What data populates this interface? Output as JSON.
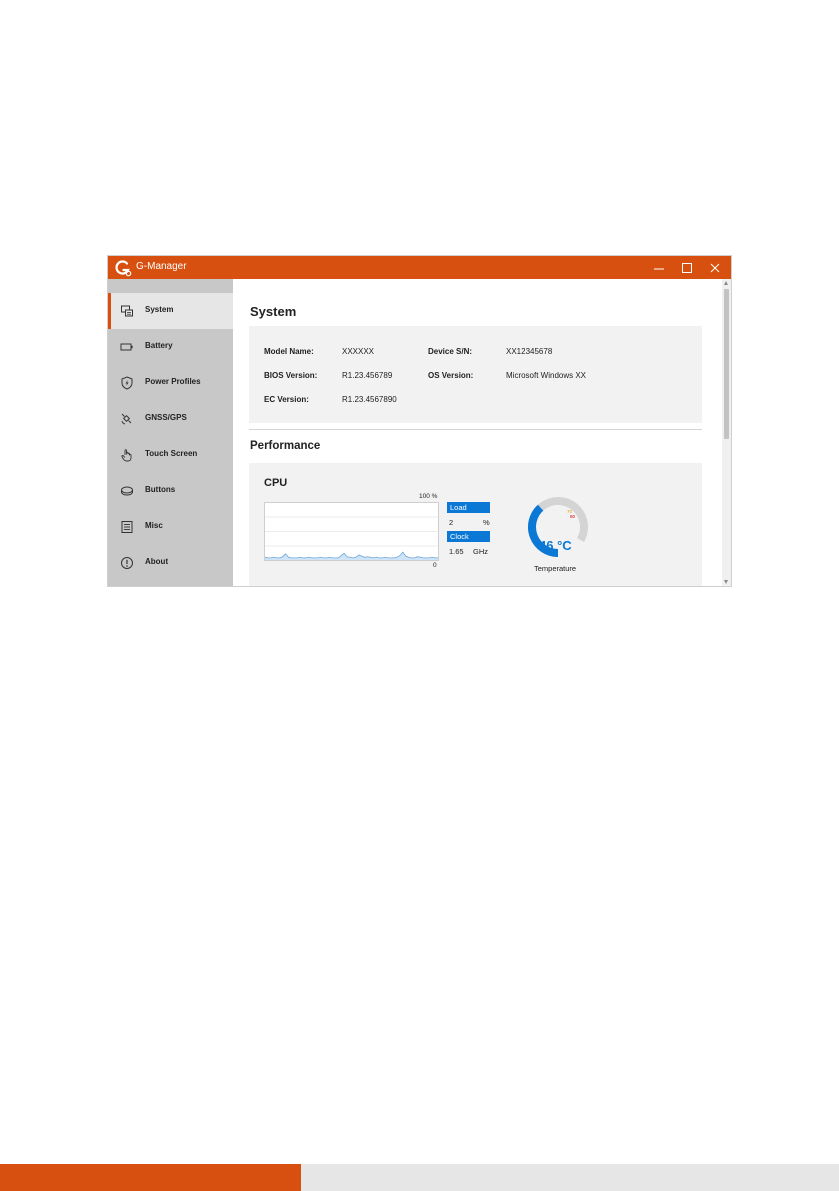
{
  "window": {
    "title": "G-Manager",
    "accent": "#d8500f"
  },
  "sidebar": {
    "items": [
      {
        "label": "System",
        "icon": "system-icon",
        "active": true
      },
      {
        "label": "Battery",
        "icon": "battery-icon"
      },
      {
        "label": "Power Profiles",
        "icon": "power-shield-icon"
      },
      {
        "label": "GNSS/GPS",
        "icon": "satellite-icon"
      },
      {
        "label": "Touch Screen",
        "icon": "hand-touch-icon"
      },
      {
        "label": "Buttons",
        "icon": "buttons-icon"
      },
      {
        "label": "Misc",
        "icon": "misc-list-icon"
      },
      {
        "label": "About",
        "icon": "info-icon"
      }
    ]
  },
  "system": {
    "heading": "System",
    "fields": {
      "model_label": "Model Name:",
      "model_value": "XXXXXX",
      "serial_label": "Device S/N:",
      "serial_value": "XX12345678",
      "bios_label": "BIOS Version:",
      "bios_value": "R1.23.456789",
      "os_label": "OS Version:",
      "os_value": "Microsoft Windows XX",
      "ec_label": "EC Version:",
      "ec_value": "R1.23.4567890"
    }
  },
  "performance": {
    "heading": "Performance",
    "cpu": {
      "title": "CPU",
      "graph_max_label": "100 %",
      "graph_min_label": "0",
      "load_label": "Load",
      "load_value": "2",
      "load_unit": "%",
      "clock_label": "Clock",
      "clock_value": "1.65",
      "clock_unit": "GHz",
      "temperature_value": "46 °C",
      "temperature_label": "Temperature",
      "temperature_fraction": 0.46,
      "gauge_mark_warn": "70",
      "gauge_mark_crit": "80",
      "load_history": [
        3,
        2,
        2,
        3,
        2,
        2,
        4,
        9,
        3,
        2,
        2,
        2,
        3,
        2,
        2,
        3,
        2,
        2,
        2,
        3,
        2,
        2,
        3,
        2,
        2,
        2,
        6,
        10,
        4,
        3,
        2,
        3,
        7,
        5,
        3,
        4,
        3,
        2,
        3,
        2,
        2,
        3,
        2,
        2,
        2,
        3,
        6,
        12,
        5,
        3,
        2,
        2,
        4,
        3,
        2,
        2,
        2,
        3,
        2,
        2
      ]
    }
  },
  "colors": {
    "accent": "#d8500f",
    "blue": "#0a78d4",
    "sidebar_bg": "#c8c8c8",
    "panel_bg": "#f2f2f2"
  }
}
